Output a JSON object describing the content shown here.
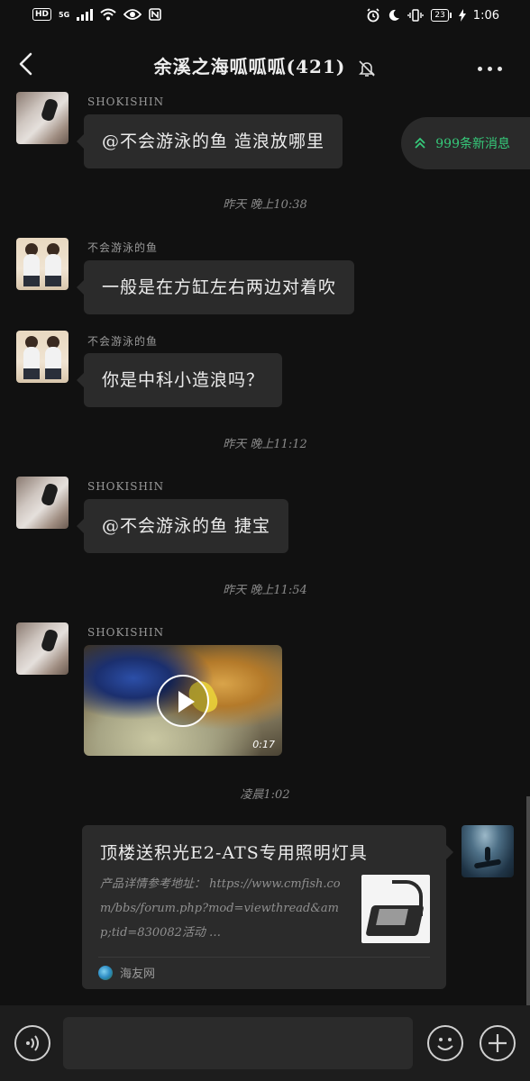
{
  "status_bar": {
    "hd": "HD",
    "network": "5G",
    "battery": "23",
    "time": "1:06"
  },
  "header": {
    "title": "余溪之海呱呱呱(421)",
    "icons": [
      "back-arrow-icon",
      "bell-muted-icon",
      "more-dots-icon"
    ]
  },
  "new_messages": {
    "label": "999条新消息",
    "color": "#36c97a"
  },
  "messages": [
    {
      "sender": "SHOKISHIN",
      "text": "@不会游泳的鱼 造浪放哪里"
    },
    {
      "timestamp": "昨天 晚上10:38"
    },
    {
      "sender": "不会游泳的鱼",
      "text": "一般是在方缸左右两边对着吹"
    },
    {
      "sender": "不会游泳的鱼",
      "text": "你是中科小造浪吗？"
    },
    {
      "timestamp": "昨天 晚上11:12"
    },
    {
      "sender": "SHOKISHIN",
      "text": "@不会游泳的鱼 捷宝"
    },
    {
      "timestamp": "昨天 晚上11:54"
    },
    {
      "sender": "SHOKISHIN",
      "video_duration": "0:17"
    },
    {
      "timestamp": "凌晨1:02"
    }
  ],
  "link_card": {
    "title": "顶楼送积光E2-ATS专用照明灯具",
    "description": "产品详情参考地址：  https://www.cmfish.com/bbs/forum.php?mod=viewthread&amp;tid=830082活动 …",
    "source": "海友网"
  },
  "input_bar": {
    "placeholder": "",
    "icons": [
      "voice-icon",
      "emoji-icon",
      "plus-icon"
    ]
  },
  "colors": {
    "background": "#111111",
    "bubble": "#2b2b2b",
    "accent_green": "#36c97a"
  }
}
